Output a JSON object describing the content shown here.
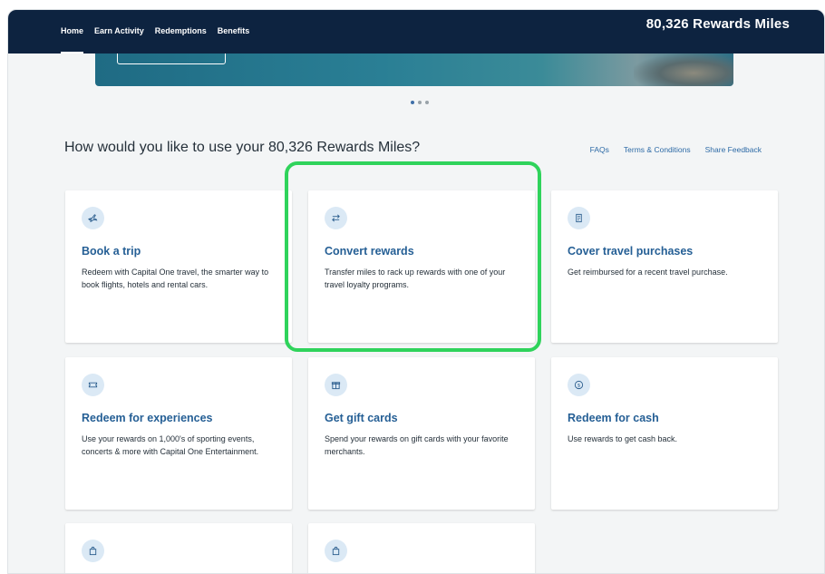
{
  "nav": {
    "items": [
      "Home",
      "Earn Activity",
      "Redemptions",
      "Benefits"
    ]
  },
  "header": {
    "miles": "80,326 Rewards Miles"
  },
  "carousel": {
    "total_dots": 3,
    "active_dot": 1
  },
  "prompt": "How would you like to use your 80,326 Rewards Miles?",
  "links": [
    "FAQs",
    "Terms & Conditions",
    "Share Feedback"
  ],
  "cards": [
    {
      "icon": "airplane-icon",
      "title": "Book a trip",
      "desc": "Redeem with Capital One travel, the smarter way to book flights, hotels and rental cars."
    },
    {
      "icon": "transfer-arrows-icon",
      "title": "Convert rewards",
      "desc": "Transfer miles to rack up rewards with one of your travel loyalty programs."
    },
    {
      "icon": "receipt-icon",
      "title": "Cover travel purchases",
      "desc": "Get reimbursed for a recent travel purchase."
    },
    {
      "icon": "ticket-icon",
      "title": "Redeem for experiences",
      "desc": "Use your rewards on 1,000's of sporting events, concerts & more with Capital One Entertainment."
    },
    {
      "icon": "gift-icon",
      "title": "Get gift cards",
      "desc": "Spend your rewards on gift cards with your favorite merchants."
    },
    {
      "icon": "dollar-coin-icon",
      "title": "Redeem for cash",
      "desc": "Use rewards to get cash back."
    },
    {
      "icon": "shopping-bag-icon",
      "title": "",
      "desc": ""
    },
    {
      "icon": "shopping-bag-icon",
      "title": "",
      "desc": ""
    }
  ],
  "colors": {
    "topbar": "#0d2340",
    "accent": "#255f95",
    "highlight": "#2fd35b"
  }
}
